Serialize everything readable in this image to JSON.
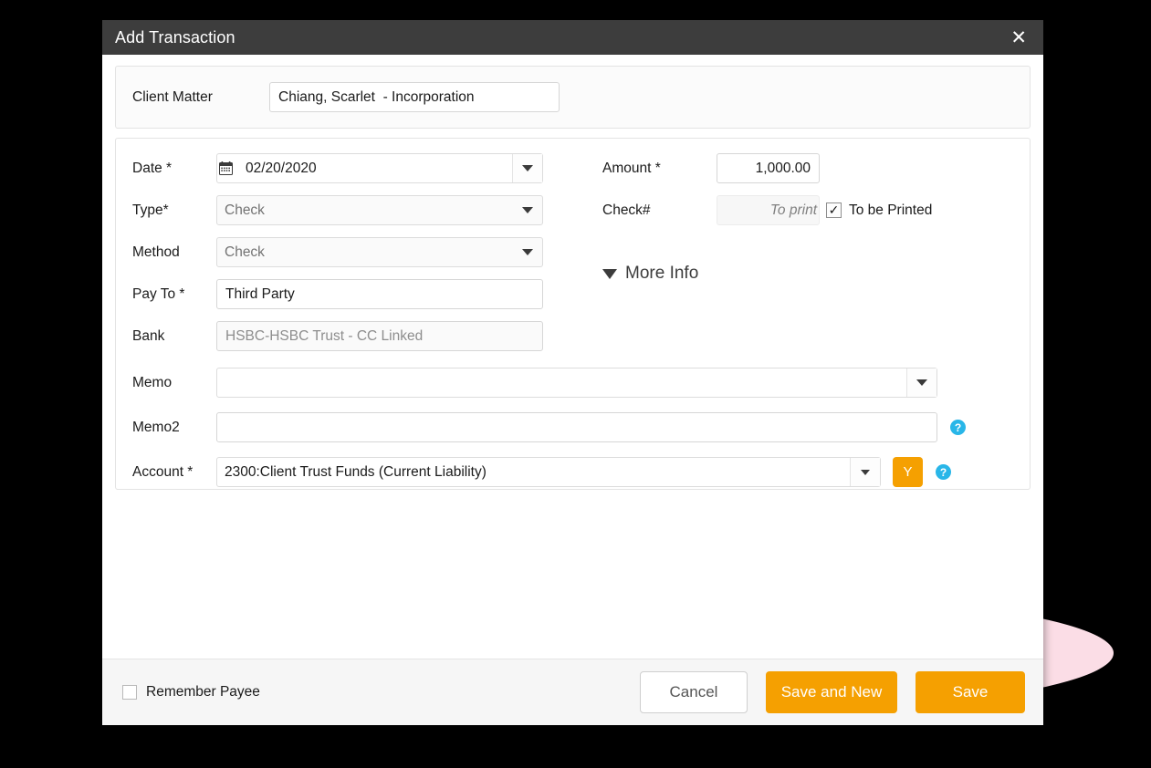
{
  "window": {
    "title": "Add Transaction",
    "close_icon": "close-icon"
  },
  "client_matter": {
    "label": "Client Matter",
    "value": "Chiang, Scarlet  - Incorporation"
  },
  "form": {
    "date": {
      "label": "Date *",
      "value": "02/20/2020",
      "icon": "calendar-icon",
      "caret": "chevron-down-icon"
    },
    "type": {
      "label": "Type*",
      "value": "Check",
      "caret": "chevron-down-icon"
    },
    "method": {
      "label": "Method",
      "value": "Check",
      "caret": "chevron-down-icon"
    },
    "pay_to": {
      "label": "Pay To *",
      "value": "Third Party"
    },
    "bank": {
      "label": "Bank",
      "value": "HSBC-HSBC Trust - CC Linked"
    },
    "memo": {
      "label": "Memo",
      "value": "",
      "caret": "chevron-down-icon"
    },
    "memo2": {
      "label": "Memo2",
      "value": "",
      "help": "?"
    },
    "account": {
      "label": "Account *",
      "value": "2300:Client Trust Funds (Current Liability)",
      "caret": "chevron-down-icon",
      "y_button": "Y",
      "help": "?"
    },
    "amount": {
      "label": "Amount *",
      "value": "1,000.00"
    },
    "check_number": {
      "label": "Check#",
      "placeholder": "To print",
      "value": "",
      "to_be_printed_label": "To be Printed",
      "to_be_printed_checked": true,
      "check_glyph": "✓"
    },
    "more_info": {
      "label": "More Info",
      "icon": "triangle-down-icon"
    }
  },
  "footer": {
    "remember_payee_label": "Remember Payee",
    "remember_payee_checked": false,
    "cancel_label": "Cancel",
    "save_and_new_label": "Save and New",
    "save_label": "Save"
  },
  "colors": {
    "accent_orange": "#f5a001",
    "titlebar": "#3d3d3d",
    "help_blue": "#29b6e8",
    "blob_pink": "#fbdde6"
  }
}
